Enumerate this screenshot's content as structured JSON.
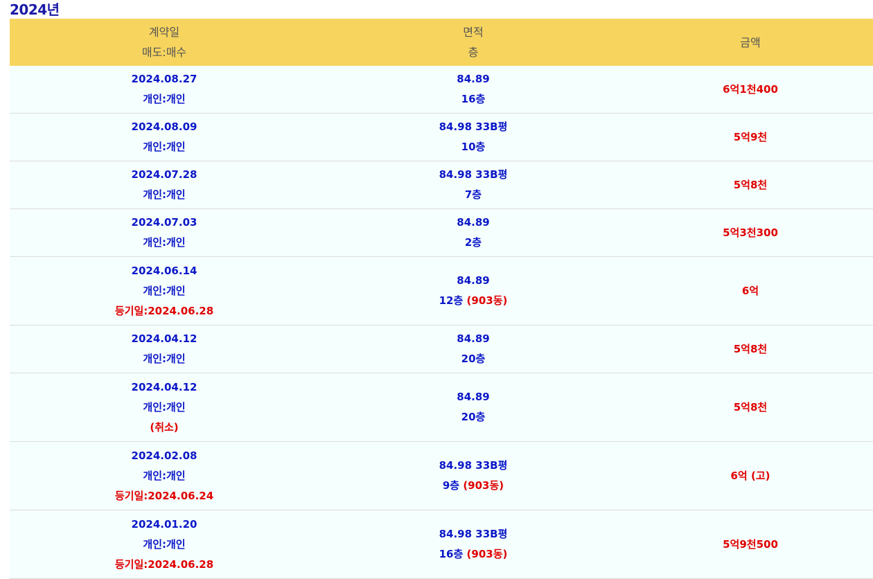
{
  "year_title": "2024년",
  "header": {
    "col1_line1": "계약일",
    "col1_line2": "매도:매수",
    "col2_line1": "면적",
    "col2_line2": "층",
    "col3": "금액"
  },
  "rows": [
    {
      "date": "2024.08.27",
      "parties": "개인:개인",
      "area": "84.89",
      "floor": "16층",
      "price": "6억1천400"
    },
    {
      "date": "2024.08.09",
      "parties": "개인:개인",
      "area": "84.98 33B평",
      "floor": "10층",
      "price": "5억9천"
    },
    {
      "date": "2024.07.28",
      "parties": "개인:개인",
      "area": "84.98 33B평",
      "floor": "7층",
      "price": "5억8천"
    },
    {
      "date": "2024.07.03",
      "parties": "개인:개인",
      "area": "84.89",
      "floor": "2층",
      "price": "5억3천300"
    },
    {
      "date": "2024.06.14",
      "parties": "개인:개인",
      "extra": "등기일:2024.06.28",
      "area": "84.89",
      "floor": "12층",
      "dong": "(903동)",
      "price": "6억"
    },
    {
      "date": "2024.04.12",
      "parties": "개인:개인",
      "area": "84.89",
      "floor": "20층",
      "price": "5억8천"
    },
    {
      "date": "2024.04.12",
      "parties": "개인:개인",
      "extra": "(취소)",
      "area": "84.89",
      "floor": "20층",
      "price": "5억8천"
    },
    {
      "date": "2024.02.08",
      "parties": "개인:개인",
      "extra": "등기일:2024.06.24",
      "area": "84.98 33B평",
      "floor": "9층",
      "dong": "(903동)",
      "price": "6억 (고)"
    },
    {
      "date": "2024.01.20",
      "parties": "개인:개인",
      "extra": "등기일:2024.06.28",
      "area": "84.98 33B평",
      "floor": "16층",
      "dong": "(903동)",
      "price": "5억9천500"
    }
  ]
}
